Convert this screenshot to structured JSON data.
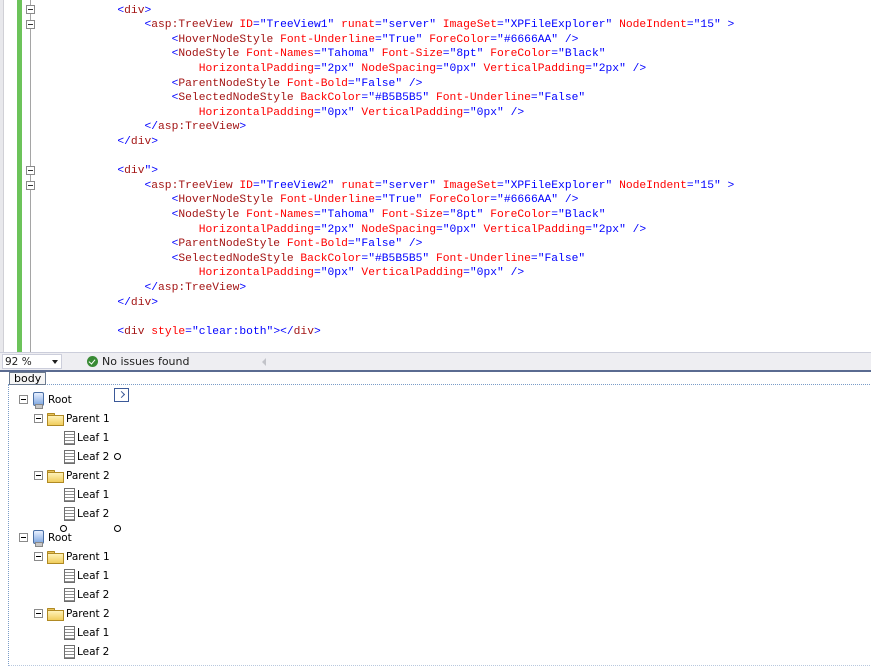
{
  "editor": {
    "lines": [
      [
        [
          "i",
          "            "
        ],
        [
          "p",
          "<"
        ],
        [
          "t",
          "div"
        ],
        [
          "p",
          ">"
        ]
      ],
      [
        [
          "i",
          "                "
        ],
        [
          "p",
          "<"
        ],
        [
          "t",
          "asp:TreeView"
        ],
        [
          "x",
          " "
        ],
        [
          "a",
          "ID"
        ],
        [
          "p",
          "="
        ],
        [
          "v",
          "\"TreeView1\""
        ],
        [
          "x",
          " "
        ],
        [
          "a",
          "runat"
        ],
        [
          "p",
          "="
        ],
        [
          "v",
          "\"server\""
        ],
        [
          "x",
          " "
        ],
        [
          "a",
          "ImageSet"
        ],
        [
          "p",
          "="
        ],
        [
          "v",
          "\"XPFileExplorer\""
        ],
        [
          "x",
          " "
        ],
        [
          "a",
          "NodeIndent"
        ],
        [
          "p",
          "="
        ],
        [
          "v",
          "\"15\""
        ],
        [
          "x",
          " "
        ],
        [
          "p",
          ">"
        ]
      ],
      [
        [
          "i",
          "                    "
        ],
        [
          "p",
          "<"
        ],
        [
          "t",
          "HoverNodeStyle"
        ],
        [
          "x",
          " "
        ],
        [
          "a",
          "Font-Underline"
        ],
        [
          "p",
          "="
        ],
        [
          "v",
          "\"True\""
        ],
        [
          "x",
          " "
        ],
        [
          "a",
          "ForeColor"
        ],
        [
          "p",
          "="
        ],
        [
          "v",
          "\"#6666AA\""
        ],
        [
          "x",
          " "
        ],
        [
          "p",
          "/>"
        ]
      ],
      [
        [
          "i",
          "                    "
        ],
        [
          "p",
          "<"
        ],
        [
          "t",
          "NodeStyle"
        ],
        [
          "x",
          " "
        ],
        [
          "a",
          "Font-Names"
        ],
        [
          "p",
          "="
        ],
        [
          "v",
          "\"Tahoma\""
        ],
        [
          "x",
          " "
        ],
        [
          "a",
          "Font-Size"
        ],
        [
          "p",
          "="
        ],
        [
          "v",
          "\"8pt\""
        ],
        [
          "x",
          " "
        ],
        [
          "a",
          "ForeColor"
        ],
        [
          "p",
          "="
        ],
        [
          "v",
          "\"Black\""
        ]
      ],
      [
        [
          "i",
          "                        "
        ],
        [
          "a",
          "HorizontalPadding"
        ],
        [
          "p",
          "="
        ],
        [
          "v",
          "\"2px\""
        ],
        [
          "x",
          " "
        ],
        [
          "a",
          "NodeSpacing"
        ],
        [
          "p",
          "="
        ],
        [
          "v",
          "\"0px\""
        ],
        [
          "x",
          " "
        ],
        [
          "a",
          "VerticalPadding"
        ],
        [
          "p",
          "="
        ],
        [
          "v",
          "\"2px\""
        ],
        [
          "x",
          " "
        ],
        [
          "p",
          "/>"
        ]
      ],
      [
        [
          "i",
          "                    "
        ],
        [
          "p",
          "<"
        ],
        [
          "t",
          "ParentNodeStyle"
        ],
        [
          "x",
          " "
        ],
        [
          "a",
          "Font-Bold"
        ],
        [
          "p",
          "="
        ],
        [
          "v",
          "\"False\""
        ],
        [
          "x",
          " "
        ],
        [
          "p",
          "/>"
        ]
      ],
      [
        [
          "i",
          "                    "
        ],
        [
          "p",
          "<"
        ],
        [
          "t",
          "SelectedNodeStyle"
        ],
        [
          "x",
          " "
        ],
        [
          "a",
          "BackColor"
        ],
        [
          "p",
          "="
        ],
        [
          "v",
          "\"#B5B5B5\""
        ],
        [
          "x",
          " "
        ],
        [
          "a",
          "Font-Underline"
        ],
        [
          "p",
          "="
        ],
        [
          "v",
          "\"False\""
        ]
      ],
      [
        [
          "i",
          "                        "
        ],
        [
          "a",
          "HorizontalPadding"
        ],
        [
          "p",
          "="
        ],
        [
          "v",
          "\"0px\""
        ],
        [
          "x",
          " "
        ],
        [
          "a",
          "VerticalPadding"
        ],
        [
          "p",
          "="
        ],
        [
          "v",
          "\"0px\""
        ],
        [
          "x",
          " "
        ],
        [
          "p",
          "/>"
        ]
      ],
      [
        [
          "i",
          "                "
        ],
        [
          "p",
          "</"
        ],
        [
          "t",
          "asp:TreeView"
        ],
        [
          "p",
          ">"
        ]
      ],
      [
        [
          "i",
          "            "
        ],
        [
          "p",
          "</"
        ],
        [
          "t",
          "div"
        ],
        [
          "p",
          ">"
        ]
      ],
      [],
      [
        [
          "i",
          "            "
        ],
        [
          "p",
          "<"
        ],
        [
          "t",
          "div"
        ],
        [
          "p",
          "\">"
        ]
      ],
      [
        [
          "i",
          "                "
        ],
        [
          "p",
          "<"
        ],
        [
          "t",
          "asp:TreeView"
        ],
        [
          "x",
          " "
        ],
        [
          "a",
          "ID"
        ],
        [
          "p",
          "="
        ],
        [
          "v",
          "\"TreeView2\""
        ],
        [
          "x",
          " "
        ],
        [
          "a",
          "runat"
        ],
        [
          "p",
          "="
        ],
        [
          "v",
          "\"server\""
        ],
        [
          "x",
          " "
        ],
        [
          "a",
          "ImageSet"
        ],
        [
          "p",
          "="
        ],
        [
          "v",
          "\"XPFileExplorer\""
        ],
        [
          "x",
          " "
        ],
        [
          "a",
          "NodeIndent"
        ],
        [
          "p",
          "="
        ],
        [
          "v",
          "\"15\""
        ],
        [
          "x",
          " "
        ],
        [
          "p",
          ">"
        ]
      ],
      [
        [
          "i",
          "                    "
        ],
        [
          "p",
          "<"
        ],
        [
          "t",
          "HoverNodeStyle"
        ],
        [
          "x",
          " "
        ],
        [
          "a",
          "Font-Underline"
        ],
        [
          "p",
          "="
        ],
        [
          "v",
          "\"True\""
        ],
        [
          "x",
          " "
        ],
        [
          "a",
          "ForeColor"
        ],
        [
          "p",
          "="
        ],
        [
          "v",
          "\"#6666AA\""
        ],
        [
          "x",
          " "
        ],
        [
          "p",
          "/>"
        ]
      ],
      [
        [
          "i",
          "                    "
        ],
        [
          "p",
          "<"
        ],
        [
          "t",
          "NodeStyle"
        ],
        [
          "x",
          " "
        ],
        [
          "a",
          "Font-Names"
        ],
        [
          "p",
          "="
        ],
        [
          "v",
          "\"Tahoma\""
        ],
        [
          "x",
          " "
        ],
        [
          "a",
          "Font-Size"
        ],
        [
          "p",
          "="
        ],
        [
          "v",
          "\"8pt\""
        ],
        [
          "x",
          " "
        ],
        [
          "a",
          "ForeColor"
        ],
        [
          "p",
          "="
        ],
        [
          "v",
          "\"Black\""
        ]
      ],
      [
        [
          "i",
          "                        "
        ],
        [
          "a",
          "HorizontalPadding"
        ],
        [
          "p",
          "="
        ],
        [
          "v",
          "\"2px\""
        ],
        [
          "x",
          " "
        ],
        [
          "a",
          "NodeSpacing"
        ],
        [
          "p",
          "="
        ],
        [
          "v",
          "\"0px\""
        ],
        [
          "x",
          " "
        ],
        [
          "a",
          "VerticalPadding"
        ],
        [
          "p",
          "="
        ],
        [
          "v",
          "\"2px\""
        ],
        [
          "x",
          " "
        ],
        [
          "p",
          "/>"
        ]
      ],
      [
        [
          "i",
          "                    "
        ],
        [
          "p",
          "<"
        ],
        [
          "t",
          "ParentNodeStyle"
        ],
        [
          "x",
          " "
        ],
        [
          "a",
          "Font-Bold"
        ],
        [
          "p",
          "="
        ],
        [
          "v",
          "\"False\""
        ],
        [
          "x",
          " "
        ],
        [
          "p",
          "/>"
        ]
      ],
      [
        [
          "i",
          "                    "
        ],
        [
          "p",
          "<"
        ],
        [
          "t",
          "SelectedNodeStyle"
        ],
        [
          "x",
          " "
        ],
        [
          "a",
          "BackColor"
        ],
        [
          "p",
          "="
        ],
        [
          "v",
          "\"#B5B5B5\""
        ],
        [
          "x",
          " "
        ],
        [
          "a",
          "Font-Underline"
        ],
        [
          "p",
          "="
        ],
        [
          "v",
          "\"False\""
        ]
      ],
      [
        [
          "i",
          "                        "
        ],
        [
          "a",
          "HorizontalPadding"
        ],
        [
          "p",
          "="
        ],
        [
          "v",
          "\"0px\""
        ],
        [
          "x",
          " "
        ],
        [
          "a",
          "VerticalPadding"
        ],
        [
          "p",
          "="
        ],
        [
          "v",
          "\"0px\""
        ],
        [
          "x",
          " "
        ],
        [
          "p",
          "/>"
        ]
      ],
      [
        [
          "i",
          "                "
        ],
        [
          "p",
          "</"
        ],
        [
          "t",
          "asp:TreeView"
        ],
        [
          "p",
          ">"
        ]
      ],
      [
        [
          "i",
          "            "
        ],
        [
          "p",
          "</"
        ],
        [
          "t",
          "div"
        ],
        [
          "p",
          ">"
        ]
      ],
      [],
      [
        [
          "i",
          "            "
        ],
        [
          "p",
          "<"
        ],
        [
          "t",
          "div"
        ],
        [
          "x",
          " "
        ],
        [
          "a",
          "style"
        ],
        [
          "p",
          "="
        ],
        [
          "v",
          "\"clear:both\""
        ],
        [
          "p",
          "></"
        ],
        [
          "t",
          "div"
        ],
        [
          "p",
          ">"
        ]
      ]
    ]
  },
  "statusbar": {
    "zoom": "92 %",
    "issues": "No issues found"
  },
  "design": {
    "body_tag": "body",
    "tree1": {
      "root": "Root",
      "parents": [
        {
          "label": "Parent 1",
          "leaves": [
            "Leaf 1",
            "Leaf 2"
          ]
        },
        {
          "label": "Parent 2",
          "leaves": [
            "Leaf 1",
            "Leaf 2"
          ]
        }
      ]
    },
    "tree2": {
      "root": "Root",
      "parents": [
        {
          "label": "Parent 1",
          "leaves": [
            "Leaf 1",
            "Leaf 2"
          ]
        },
        {
          "label": "Parent 2",
          "leaves": [
            "Leaf 1",
            "Leaf 2"
          ]
        }
      ]
    }
  },
  "colors": {
    "tag": "#a31515",
    "attribute": "#ff0000",
    "value": "#0000ff",
    "change_bar": "#6cc35a",
    "splitter": "#5a6b91"
  }
}
